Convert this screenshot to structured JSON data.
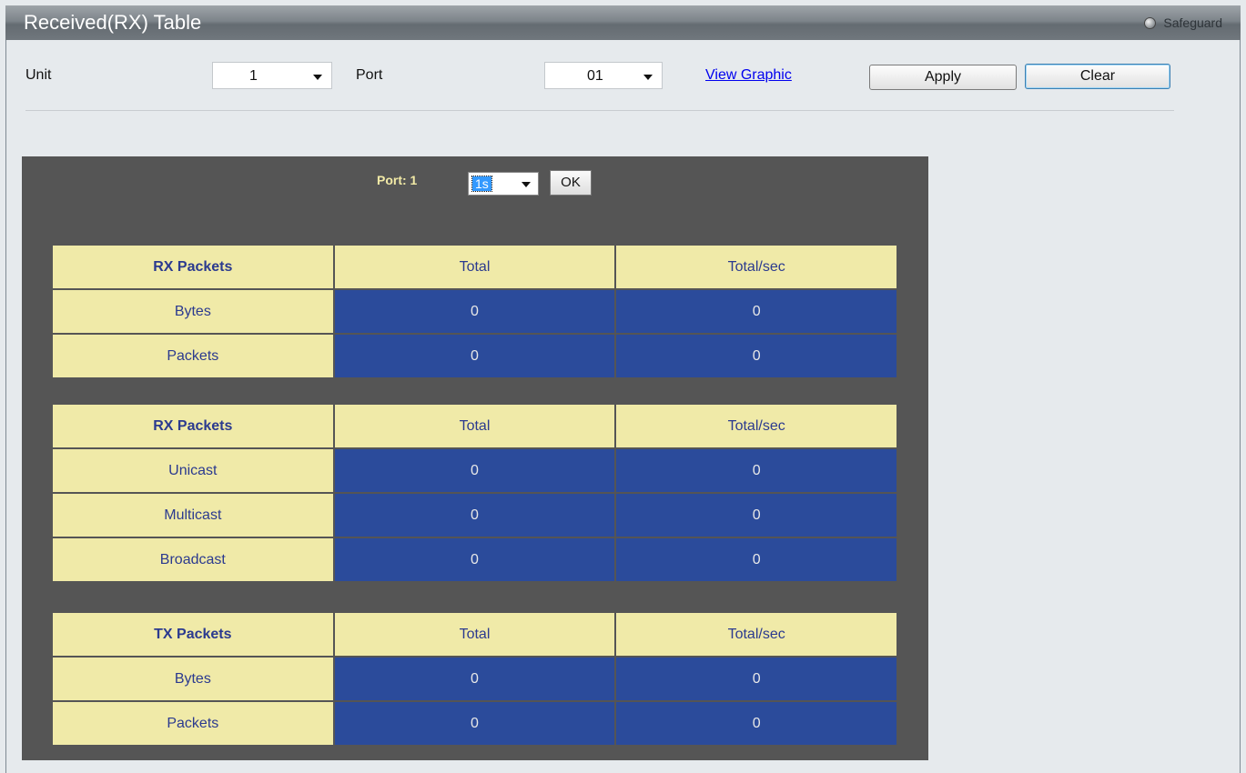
{
  "window": {
    "title": "Received(RX) Table",
    "safeguard_label": "Safeguard"
  },
  "filters": {
    "unit_label": "Unit",
    "unit_value": "1",
    "port_label": "Port",
    "port_value": "01",
    "view_graphic_link": "View Graphic",
    "apply_label": "Apply",
    "clear_label": "Clear"
  },
  "panel": {
    "port_label": "Port: 1",
    "interval_value": "1s",
    "ok_label": "OK"
  },
  "tables": [
    {
      "headers": [
        "RX Packets",
        "Total",
        "Total/sec"
      ],
      "rows": [
        {
          "label": "Bytes",
          "total": "0",
          "per_sec": "0"
        },
        {
          "label": "Packets",
          "total": "0",
          "per_sec": "0"
        }
      ]
    },
    {
      "headers": [
        "RX Packets",
        "Total",
        "Total/sec"
      ],
      "rows": [
        {
          "label": "Unicast",
          "total": "0",
          "per_sec": "0"
        },
        {
          "label": "Multicast",
          "total": "0",
          "per_sec": "0"
        },
        {
          "label": "Broadcast",
          "total": "0",
          "per_sec": "0"
        }
      ]
    },
    {
      "headers": [
        "TX Packets",
        "Total",
        "Total/sec"
      ],
      "rows": [
        {
          "label": "Bytes",
          "total": "0",
          "per_sec": "0"
        },
        {
          "label": "Packets",
          "total": "0",
          "per_sec": "0"
        }
      ]
    }
  ]
}
